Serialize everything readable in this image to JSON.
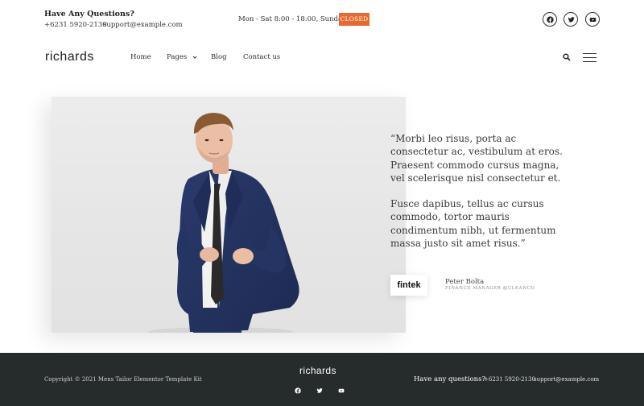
{
  "topbar": {
    "question_title": "Have Any Questions?",
    "phone": "+6231 5920-2130",
    "email": "support@example.com",
    "hours": "Mon - Sat 8:00 - 18:00,  Sunday",
    "closed_badge": "CLOSED",
    "social_icons": [
      "facebook-icon",
      "twitter-icon",
      "youtube-icon"
    ]
  },
  "nav": {
    "logo": "richards",
    "items": [
      {
        "label": "Home"
      },
      {
        "label": "Pages",
        "has_dropdown": true
      },
      {
        "label": "Blog"
      },
      {
        "label": "Contact us"
      }
    ],
    "icons": [
      "search-icon",
      "hamburger-menu-icon"
    ]
  },
  "testimonial": {
    "image": "man-in-navy-suit-photo",
    "quote_paragraph_1": "“Morbi leo risus, porta ac consectetur ac, vestibulum at eros. Praesent commodo cursus magna, vel scelerisque nisl consectetur et.",
    "quote_paragraph_2": "Fusce dapibus, tellus ac cursus commodo, tortor mauris condimentum nibh, ut fermentum massa justo sit amet risus.”",
    "company_logo": "fintek",
    "author_name": "Peter Bolta",
    "author_role": "FINANCE MANAGER @CLEANCO"
  },
  "footer": {
    "copyright": "Copyright © 2021 Mens Tailor Elementor Template Kit",
    "logo": "richards",
    "social_icons": [
      "facebook-icon",
      "twitter-icon",
      "youtube-icon"
    ],
    "question": "Have any questions?",
    "phone": "+6231 5920-2130",
    "email": "support@example.com"
  },
  "colors": {
    "accent": "#e8692e",
    "footer_bg": "#262b2b",
    "text": "#2b2b2b"
  }
}
